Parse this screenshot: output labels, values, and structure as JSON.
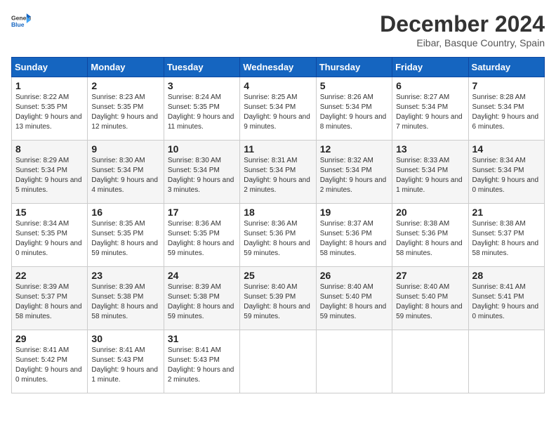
{
  "logo": {
    "general": "General",
    "blue": "Blue"
  },
  "header": {
    "month": "December 2024",
    "location": "Eibar, Basque Country, Spain"
  },
  "weekdays": [
    "Sunday",
    "Monday",
    "Tuesday",
    "Wednesday",
    "Thursday",
    "Friday",
    "Saturday"
  ],
  "weeks": [
    [
      {
        "day": 1,
        "sunrise": "8:22 AM",
        "sunset": "5:35 PM",
        "daylight": "9 hours and 13 minutes."
      },
      {
        "day": 2,
        "sunrise": "8:23 AM",
        "sunset": "5:35 PM",
        "daylight": "9 hours and 12 minutes."
      },
      {
        "day": 3,
        "sunrise": "8:24 AM",
        "sunset": "5:35 PM",
        "daylight": "9 hours and 11 minutes."
      },
      {
        "day": 4,
        "sunrise": "8:25 AM",
        "sunset": "5:34 PM",
        "daylight": "9 hours and 9 minutes."
      },
      {
        "day": 5,
        "sunrise": "8:26 AM",
        "sunset": "5:34 PM",
        "daylight": "9 hours and 8 minutes."
      },
      {
        "day": 6,
        "sunrise": "8:27 AM",
        "sunset": "5:34 PM",
        "daylight": "9 hours and 7 minutes."
      },
      {
        "day": 7,
        "sunrise": "8:28 AM",
        "sunset": "5:34 PM",
        "daylight": "9 hours and 6 minutes."
      }
    ],
    [
      {
        "day": 8,
        "sunrise": "8:29 AM",
        "sunset": "5:34 PM",
        "daylight": "9 hours and 5 minutes."
      },
      {
        "day": 9,
        "sunrise": "8:30 AM",
        "sunset": "5:34 PM",
        "daylight": "9 hours and 4 minutes."
      },
      {
        "day": 10,
        "sunrise": "8:30 AM",
        "sunset": "5:34 PM",
        "daylight": "9 hours and 3 minutes."
      },
      {
        "day": 11,
        "sunrise": "8:31 AM",
        "sunset": "5:34 PM",
        "daylight": "9 hours and 2 minutes."
      },
      {
        "day": 12,
        "sunrise": "8:32 AM",
        "sunset": "5:34 PM",
        "daylight": "9 hours and 2 minutes."
      },
      {
        "day": 13,
        "sunrise": "8:33 AM",
        "sunset": "5:34 PM",
        "daylight": "9 hours and 1 minute."
      },
      {
        "day": 14,
        "sunrise": "8:34 AM",
        "sunset": "5:34 PM",
        "daylight": "9 hours and 0 minutes."
      }
    ],
    [
      {
        "day": 15,
        "sunrise": "8:34 AM",
        "sunset": "5:35 PM",
        "daylight": "9 hours and 0 minutes."
      },
      {
        "day": 16,
        "sunrise": "8:35 AM",
        "sunset": "5:35 PM",
        "daylight": "8 hours and 59 minutes."
      },
      {
        "day": 17,
        "sunrise": "8:36 AM",
        "sunset": "5:35 PM",
        "daylight": "8 hours and 59 minutes."
      },
      {
        "day": 18,
        "sunrise": "8:36 AM",
        "sunset": "5:36 PM",
        "daylight": "8 hours and 59 minutes."
      },
      {
        "day": 19,
        "sunrise": "8:37 AM",
        "sunset": "5:36 PM",
        "daylight": "8 hours and 58 minutes."
      },
      {
        "day": 20,
        "sunrise": "8:38 AM",
        "sunset": "5:36 PM",
        "daylight": "8 hours and 58 minutes."
      },
      {
        "day": 21,
        "sunrise": "8:38 AM",
        "sunset": "5:37 PM",
        "daylight": "8 hours and 58 minutes."
      }
    ],
    [
      {
        "day": 22,
        "sunrise": "8:39 AM",
        "sunset": "5:37 PM",
        "daylight": "8 hours and 58 minutes."
      },
      {
        "day": 23,
        "sunrise": "8:39 AM",
        "sunset": "5:38 PM",
        "daylight": "8 hours and 58 minutes."
      },
      {
        "day": 24,
        "sunrise": "8:39 AM",
        "sunset": "5:38 PM",
        "daylight": "8 hours and 59 minutes."
      },
      {
        "day": 25,
        "sunrise": "8:40 AM",
        "sunset": "5:39 PM",
        "daylight": "8 hours and 59 minutes."
      },
      {
        "day": 26,
        "sunrise": "8:40 AM",
        "sunset": "5:40 PM",
        "daylight": "8 hours and 59 minutes."
      },
      {
        "day": 27,
        "sunrise": "8:40 AM",
        "sunset": "5:40 PM",
        "daylight": "8 hours and 59 minutes."
      },
      {
        "day": 28,
        "sunrise": "8:41 AM",
        "sunset": "5:41 PM",
        "daylight": "9 hours and 0 minutes."
      }
    ],
    [
      {
        "day": 29,
        "sunrise": "8:41 AM",
        "sunset": "5:42 PM",
        "daylight": "9 hours and 0 minutes."
      },
      {
        "day": 30,
        "sunrise": "8:41 AM",
        "sunset": "5:43 PM",
        "daylight": "9 hours and 1 minute."
      },
      {
        "day": 31,
        "sunrise": "8:41 AM",
        "sunset": "5:43 PM",
        "daylight": "9 hours and 2 minutes."
      },
      null,
      null,
      null,
      null
    ]
  ]
}
